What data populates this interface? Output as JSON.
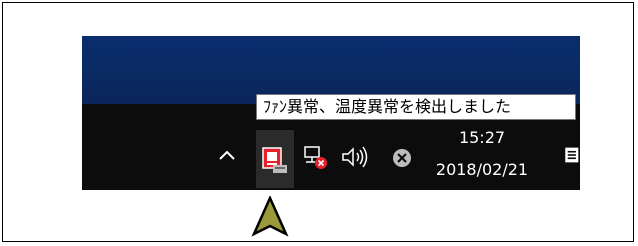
{
  "tooltip": {
    "text": "ﾌｧﾝ異常、温度異常を検出しました"
  },
  "tray": {
    "icons": {
      "show_hidden": "chevron-up-icon",
      "fan_alert": "fan-alert-icon",
      "network": "network-disconnected-icon",
      "volume": "volume-icon",
      "action_center": "close-circle-icon",
      "notifications": "notification-icon"
    },
    "clock": {
      "time": "15:27",
      "date": "2018/02/21"
    }
  },
  "pointer": {
    "icon": "arrow-pointer-icon",
    "color": "#9a9a3a"
  },
  "colors": {
    "desktop": "#0b2d6e",
    "taskbar": "#0c0c0c",
    "alert_red": "#e8202a",
    "tooltip_bg": "#ffffff"
  }
}
